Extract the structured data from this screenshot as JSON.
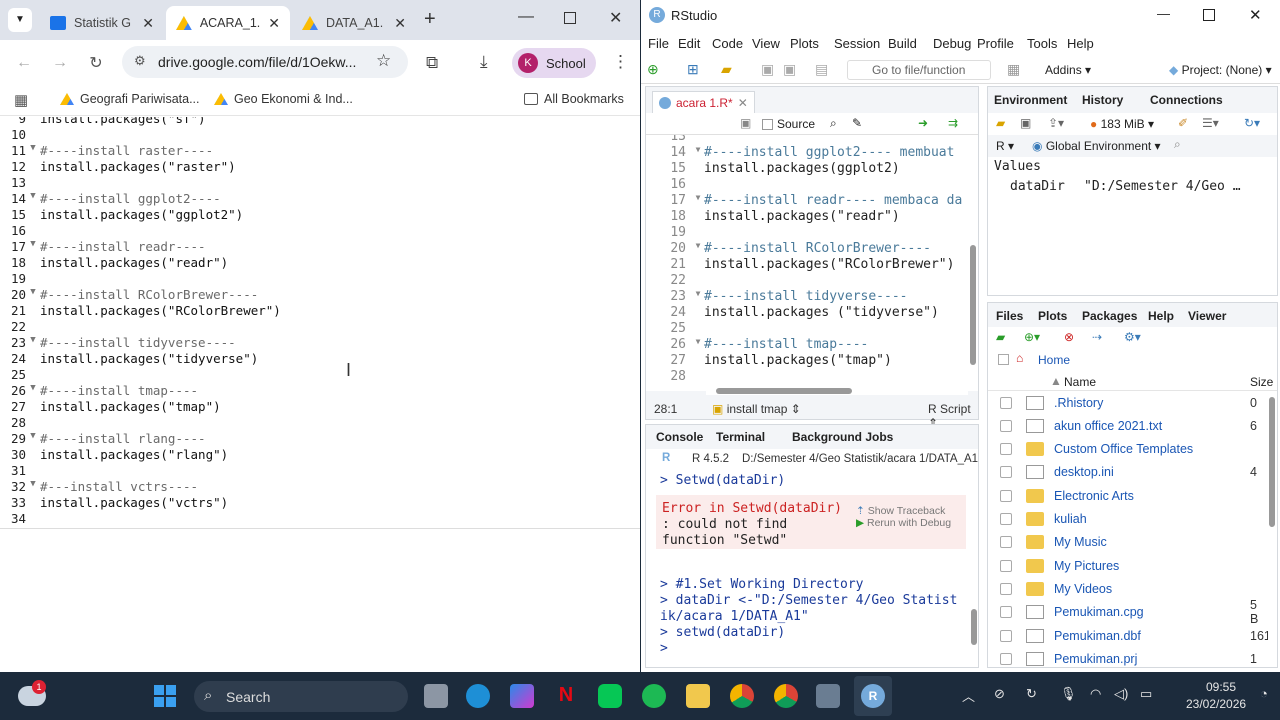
{
  "chrome": {
    "tabs": [
      {
        "title": "Statistik G",
        "active": false
      },
      {
        "title": "ACARA_1.",
        "active": true
      },
      {
        "title": "DATA_A1.",
        "active": false
      }
    ],
    "url": "drive.google.com/file/d/1Oekw...",
    "profile_initial": "K",
    "profile_label": "School",
    "bookmarks": [
      "Geografi Pariwisata...",
      "Geo Ekonomi & Ind..."
    ],
    "all_bookmarks": "All Bookmarks",
    "code_lines": [
      {
        "n": "9",
        "fold": "",
        "cmt": "",
        "code": "install.packages(\"sf\")"
      },
      {
        "n": "10",
        "fold": "",
        "cmt": "",
        "code": ""
      },
      {
        "n": "11",
        "fold": "▼",
        "cmt": "#----install raster----",
        "code": ""
      },
      {
        "n": "12",
        "fold": "",
        "cmt": "",
        "code": "install.packages(\"raster\")"
      },
      {
        "n": "13",
        "fold": "",
        "cmt": "",
        "code": ""
      },
      {
        "n": "14",
        "fold": "▼",
        "cmt": "#----install ggplot2----",
        "code": ""
      },
      {
        "n": "15",
        "fold": "",
        "cmt": "",
        "code": "install.packages(\"ggplot2\")"
      },
      {
        "n": "16",
        "fold": "",
        "cmt": "",
        "code": ""
      },
      {
        "n": "17",
        "fold": "▼",
        "cmt": "#----install readr----",
        "code": ""
      },
      {
        "n": "18",
        "fold": "",
        "cmt": "",
        "code": "install.packages(\"readr\")"
      },
      {
        "n": "19",
        "fold": "",
        "cmt": "",
        "code": ""
      },
      {
        "n": "20",
        "fold": "▼",
        "cmt": "#----install RColorBrewer----",
        "code": ""
      },
      {
        "n": "21",
        "fold": "",
        "cmt": "",
        "code": "install.packages(\"RColorBrewer\")"
      },
      {
        "n": "22",
        "fold": "",
        "cmt": "",
        "code": ""
      },
      {
        "n": "23",
        "fold": "▼",
        "cmt": "#----install tidyverse----",
        "code": ""
      },
      {
        "n": "24",
        "fold": "",
        "cmt": "",
        "code": "install.packages(\"tidyverse\")"
      },
      {
        "n": "25",
        "fold": "",
        "cmt": "",
        "code": ""
      },
      {
        "n": "26",
        "fold": "▼",
        "cmt": "#----install tmap----",
        "code": ""
      },
      {
        "n": "27",
        "fold": "",
        "cmt": "",
        "code": "install.packages(\"tmap\")"
      },
      {
        "n": "28",
        "fold": "",
        "cmt": "",
        "code": ""
      },
      {
        "n": "29",
        "fold": "▼",
        "cmt": "#----install rlang----",
        "code": ""
      },
      {
        "n": "30",
        "fold": "",
        "cmt": "",
        "code": "install.packages(\"rlang\")"
      },
      {
        "n": "31",
        "fold": "",
        "cmt": "",
        "code": ""
      },
      {
        "n": "32",
        "fold": "▼",
        "cmt": "#---install vctrs----",
        "code": ""
      },
      {
        "n": "33",
        "fold": "",
        "cmt": "",
        "code": "install.packages(\"vctrs\")"
      },
      {
        "n": "34",
        "fold": "",
        "cmt": "",
        "code": ""
      }
    ]
  },
  "rstudio": {
    "title": "RStudio",
    "menu": [
      "File",
      "Edit",
      "Code",
      "View",
      "Plots",
      "Session",
      "Build",
      "Debug",
      "Profile",
      "Tools",
      "Help"
    ],
    "goto_file": "Go to file/function",
    "addins": "Addins",
    "project": "Project: (None)",
    "editor": {
      "tab": "acara 1.R*",
      "source_label": "Source",
      "lines": [
        {
          "n": "13",
          "fold": "",
          "cmt": "",
          "code": ""
        },
        {
          "n": "14",
          "fold": "▼",
          "cmt": "#----install ggplot2---- membuat",
          "code": ""
        },
        {
          "n": "15",
          "fold": "",
          "cmt": "",
          "code": "install.packages(ggplot2)"
        },
        {
          "n": "16",
          "fold": "",
          "cmt": "",
          "code": ""
        },
        {
          "n": "17",
          "fold": "▼",
          "cmt": "#----install readr---- membaca da",
          "code": ""
        },
        {
          "n": "18",
          "fold": "",
          "cmt": "",
          "code": "install.packages(\"readr\")"
        },
        {
          "n": "19",
          "fold": "",
          "cmt": "",
          "code": ""
        },
        {
          "n": "20",
          "fold": "▼",
          "cmt": "#----install RColorBrewer----",
          "code": ""
        },
        {
          "n": "21",
          "fold": "",
          "cmt": "",
          "code": "install.packages(\"RColorBrewer\")"
        },
        {
          "n": "22",
          "fold": "",
          "cmt": "",
          "code": ""
        },
        {
          "n": "23",
          "fold": "▼",
          "cmt": "#----install tidyverse----",
          "code": ""
        },
        {
          "n": "24",
          "fold": "",
          "cmt": "",
          "code": "install.packages (\"tidyverse\")"
        },
        {
          "n": "25",
          "fold": "",
          "cmt": "",
          "code": ""
        },
        {
          "n": "26",
          "fold": "▼",
          "cmt": "#----install tmap----",
          "code": ""
        },
        {
          "n": "27",
          "fold": "",
          "cmt": "",
          "code": "install.packages(\"tmap\")"
        },
        {
          "n": "28",
          "fold": "",
          "cmt": "",
          "code": ""
        }
      ],
      "status_pos": "28:1",
      "status_section": "install tmap",
      "status_type": "R Script"
    },
    "console": {
      "tabs": [
        "Console",
        "Terminal",
        "Background Jobs"
      ],
      "r_version": "R 4.5.2",
      "path": "D:/Semester 4/Geo Statistik/acara 1/DATA_A1/",
      "cmd1": "> Setwd(dataDir)",
      "error_lines": [
        "Error in Setwd(dataDir)",
        ": could not find",
        "function \"Setwd\""
      ],
      "show_traceback": "Show Traceback",
      "rerun_debug": "Rerun with Debug",
      "lines": [
        "> #1.Set Working Directory",
        "> dataDir <-\"D:/Semester 4/Geo Statist",
        "ik/acara 1/DATA_A1\"",
        "> setwd(dataDir)",
        "> "
      ]
    },
    "environment": {
      "tabs": [
        "Environment",
        "History",
        "Connections"
      ],
      "memory": "183 MiB",
      "r_label": "R",
      "global_env": "Global Environment",
      "values_header": "Values",
      "var_name": "dataDir",
      "var_value": "\"D:/Semester 4/Geo …"
    },
    "files": {
      "tabs": [
        "Files",
        "Plots",
        "Packages",
        "Help",
        "Viewer"
      ],
      "home": "Home",
      "col_name": "Name",
      "col_size": "Size",
      "items": [
        {
          "name": ".Rhistory",
          "type": "doc",
          "size": "0"
        },
        {
          "name": "akun office 2021.txt",
          "type": "doc",
          "size": "6"
        },
        {
          "name": "Custom Office Templates",
          "type": "folder",
          "size": ""
        },
        {
          "name": "desktop.ini",
          "type": "gear",
          "size": "4"
        },
        {
          "name": "Electronic Arts",
          "type": "folder",
          "size": ""
        },
        {
          "name": "kuliah",
          "type": "folder",
          "size": ""
        },
        {
          "name": "My Music",
          "type": "folder",
          "size": ""
        },
        {
          "name": "My Pictures",
          "type": "folder",
          "size": ""
        },
        {
          "name": "My Videos",
          "type": "folder",
          "size": ""
        },
        {
          "name": "Pemukiman.cpg",
          "type": "doc",
          "size": "5 B"
        },
        {
          "name": "Pemukiman.dbf",
          "type": "doc",
          "size": "161"
        },
        {
          "name": "Pemukiman.prj",
          "type": "doc",
          "size": "1"
        }
      ]
    }
  },
  "taskbar": {
    "search_label": "Search",
    "notification_badge": "1",
    "time": "09:55",
    "date": "23/02/2026"
  }
}
